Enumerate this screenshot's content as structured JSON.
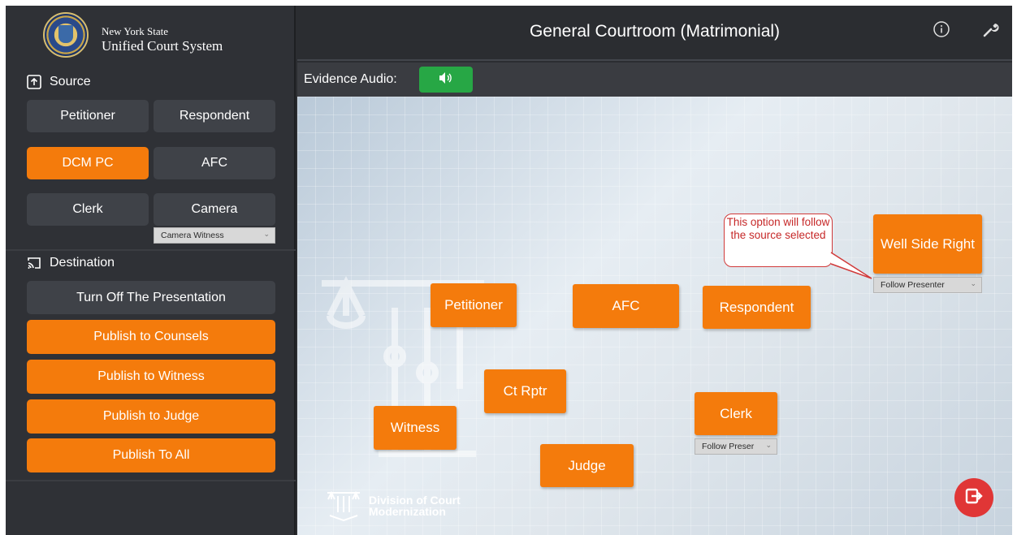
{
  "org": {
    "line1": "New York State",
    "line2": "Unified Court System"
  },
  "source": {
    "heading": "Source",
    "buttons": {
      "petitioner": "Petitioner",
      "respondent": "Respondent",
      "dcm_pc": "DCM PC",
      "afc": "AFC",
      "clerk": "Clerk",
      "camera": "Camera"
    },
    "camera_select": "Camera Witness"
  },
  "destination": {
    "heading": "Destination",
    "buttons": [
      "Turn Off The Presentation",
      "Publish to Counsels",
      "Publish to Witness",
      "Publish to Judge",
      "Publish To All"
    ]
  },
  "header": {
    "title": "General Courtroom (Matrimonial)"
  },
  "audio": {
    "label": "Evidence Audio:"
  },
  "courtroom": {
    "petitioner": "Petitioner",
    "afc": "AFC",
    "respondent": "Respondent",
    "well_side_right": "Well Side Right",
    "well_side_select": "Follow Presenter",
    "ct_rptr": "Ct Rptr",
    "witness": "Witness",
    "clerk": "Clerk",
    "clerk_select": "Follow Preser",
    "judge": "Judge",
    "callout": "This option will follow the source selected"
  },
  "brand": {
    "line1": "Division of Court",
    "line2": "Modernization"
  },
  "colors": {
    "accent": "#f47b0c",
    "audio_on": "#27a745",
    "exit": "#e03636",
    "callout_border": "#d13a3a"
  },
  "icons": [
    "upload-icon",
    "cast-icon",
    "info-icon",
    "wrench-icon",
    "speaker-icon",
    "exit-icon"
  ]
}
